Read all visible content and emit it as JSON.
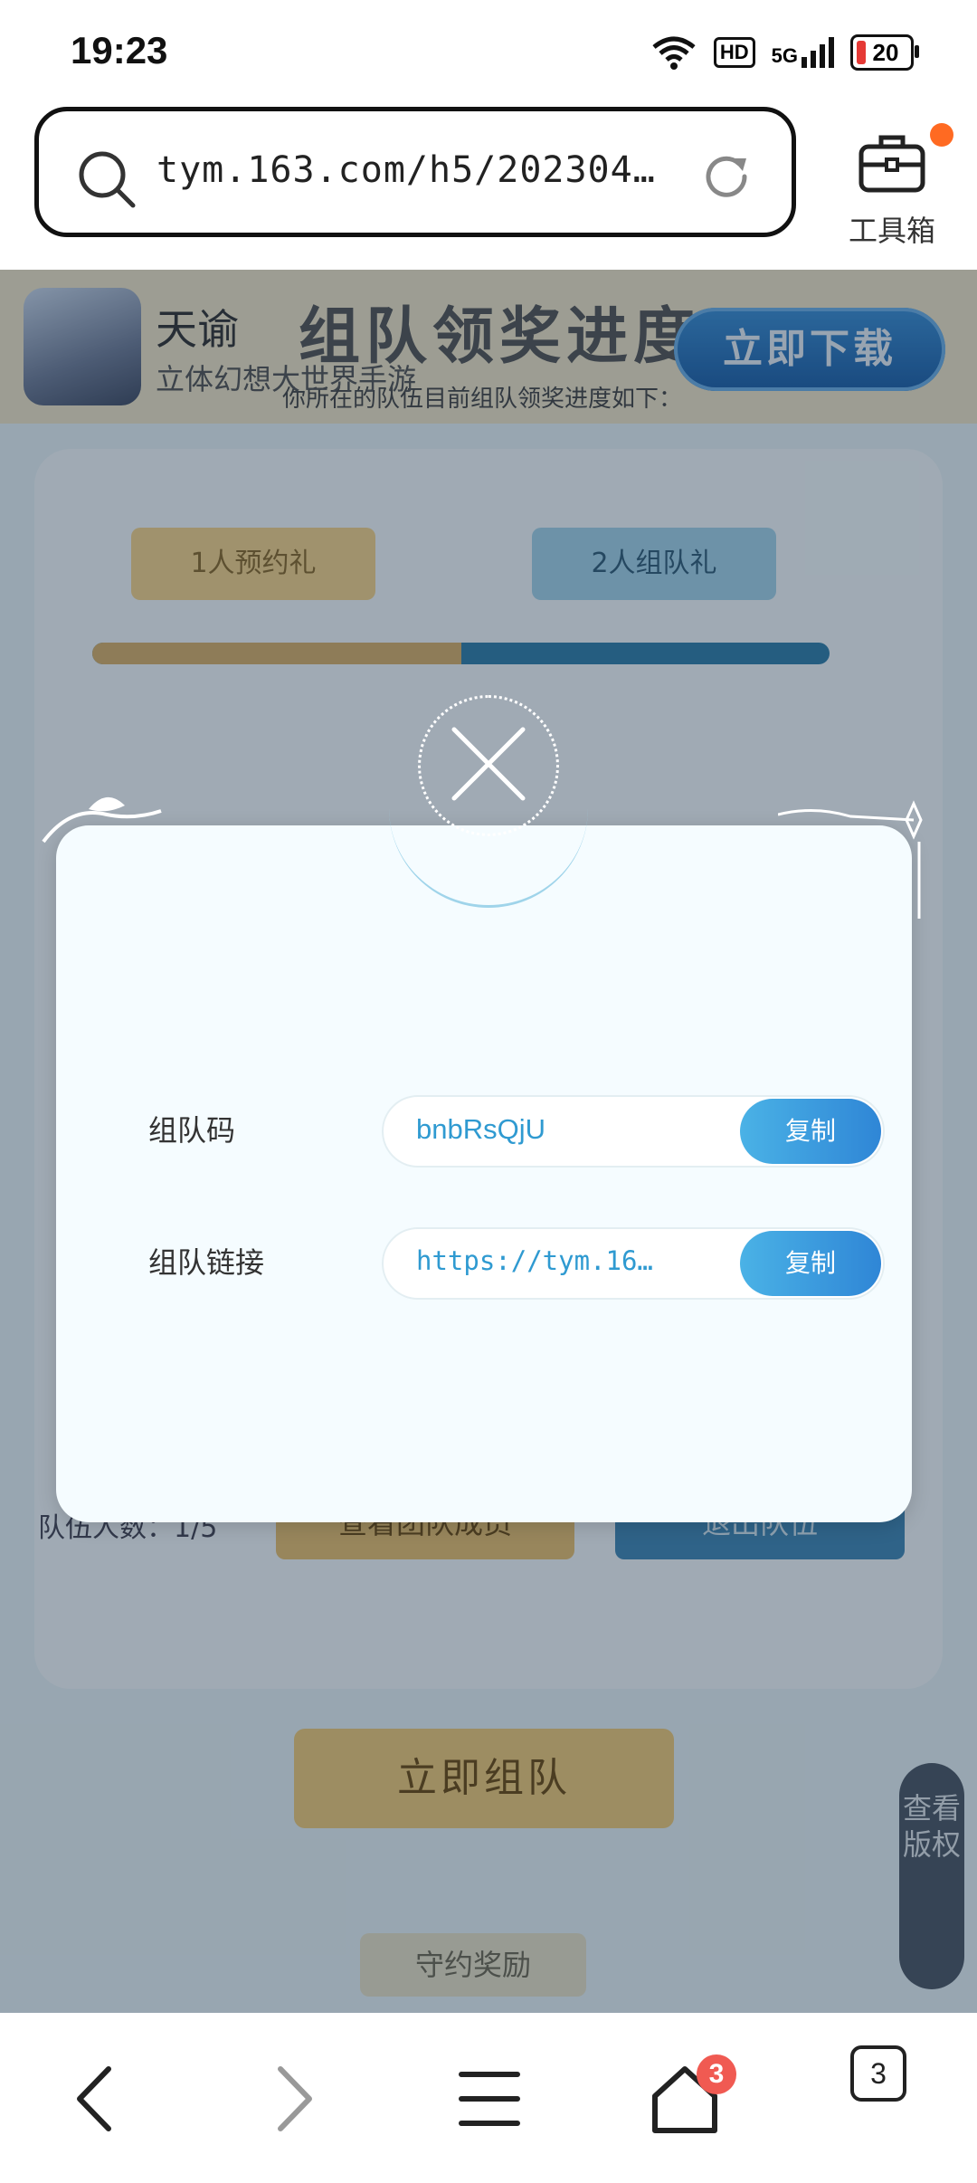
{
  "status_bar": {
    "time": "19:23",
    "network_label": "HD",
    "signal_label": "5G",
    "battery_level": "20"
  },
  "browser": {
    "url": "tym.163.com/h5/202304…",
    "toolbox_label": "工具箱"
  },
  "page": {
    "app_name": "天谕",
    "app_desc": "立体幻想大世界手游",
    "title": "组队领奖进度",
    "subtitle": "你所在的队伍目前组队领奖进度如下：",
    "download_label": "立即下载",
    "tag_1": "1人预约礼",
    "tag_2": "2人组队礼",
    "progress_fraction": 0.5,
    "team_count": "队伍人数：1/5",
    "view_members_label": "查看团队成员",
    "quit_team_label": "退出队伍",
    "form_team_label": "立即组队",
    "keep_promise_label": "守约奖励",
    "copyright_label": "查看版权"
  },
  "dialog": {
    "team_code_label": "组队码",
    "team_code_value": "bnbRsQjU",
    "team_link_label": "组队链接",
    "team_link_value": "https://tym.16…",
    "copy_label": "复制"
  },
  "bottom_nav": {
    "home_badge": "3",
    "tab_count": "3"
  }
}
